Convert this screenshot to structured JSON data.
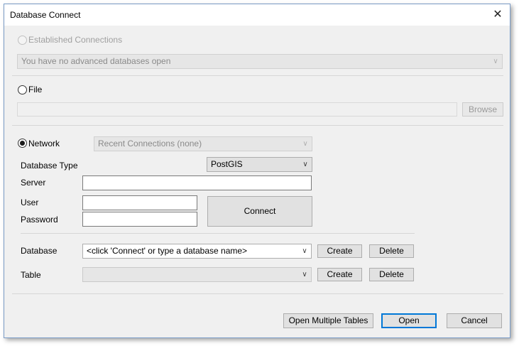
{
  "window": {
    "title": "Database Connect",
    "close_glyph": "✕"
  },
  "established": {
    "label": "Established Connections",
    "dropdown_value": "You have no advanced databases open"
  },
  "file": {
    "label": "File",
    "browse_label": "Browse",
    "path_value": ""
  },
  "network": {
    "label": "Network",
    "recent_value": "Recent Connections (none)",
    "db_type_label": "Database Type",
    "db_type_value": "PostGIS",
    "server_label": "Server",
    "user_label": "User",
    "password_label": "Password",
    "connect_label": "Connect",
    "server_value": "",
    "user_value": "",
    "password_value": ""
  },
  "database": {
    "label": "Database",
    "value": "<click 'Connect' or type a database name>",
    "create_label": "Create",
    "delete_label": "Delete"
  },
  "table": {
    "label": "Table",
    "value": "",
    "create_label": "Create",
    "delete_label": "Delete"
  },
  "footer": {
    "open_multiple_label": "Open Multiple Tables",
    "open_label": "Open",
    "cancel_label": "Cancel"
  },
  "icons": {
    "chevron": "chevron-down-icon",
    "close": "close-icon"
  },
  "colors": {
    "default_button_border": "#0078d7",
    "window_border": "#7a9cc7"
  }
}
